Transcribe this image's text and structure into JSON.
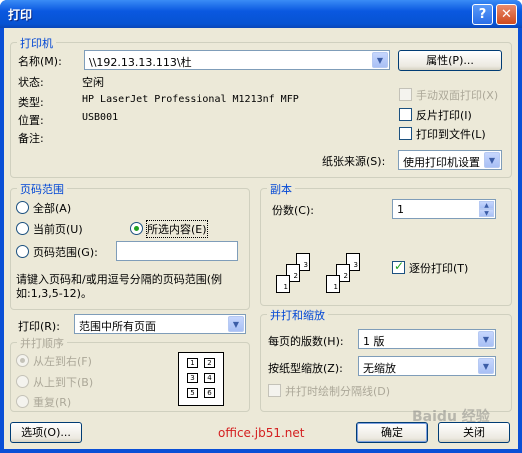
{
  "window": {
    "title": "打印",
    "help": "?",
    "close": "✕"
  },
  "printer": {
    "group_title": "打印机",
    "name_label": "名称(M):",
    "name_value": "\\\\192.13.13.113\\杜",
    "properties_btn": "属性(P)...",
    "status_label": "状态:",
    "status_value": "空闲",
    "type_label": "类型:",
    "type_value": "HP LaserJet Professional M1213nf MFP",
    "where_label": "位置:",
    "where_value": "USB001",
    "comment_label": "备注:",
    "manual_duplex": "手动双面打印(X)",
    "manual_duplex_checked": false,
    "reverse_print": "反片打印(I)",
    "reverse_checked": false,
    "print_to_file": "打印到文件(L)",
    "print_to_file_checked": false,
    "paper_source_label": "纸张来源(S):",
    "paper_source_value": "使用打印机设置"
  },
  "page_range": {
    "group_title": "页码范围",
    "all": "全部(A)",
    "current": "当前页(U)",
    "selection": "所选内容(E)",
    "pages": "页码范围(G):",
    "selected": "selection",
    "hint": "请键入页码和/或用逗号分隔的页码范围(例如:1,3,5-12)。"
  },
  "copies": {
    "group_title": "副本",
    "count_label": "份数(C):",
    "count_value": "1",
    "collate": "逐份打印(T)",
    "collate_checked": true
  },
  "print_what": {
    "label": "打印(R):",
    "value": "范围中所有页面"
  },
  "order": {
    "group_title": "并打顺序",
    "ltr": "从左到右(F)",
    "ttb": "从上到下(B)",
    "repeat": "重复(R)",
    "cells": [
      "1",
      "2",
      "3",
      "4",
      "5",
      "6"
    ]
  },
  "zoom": {
    "group_title": "并打和缩放",
    "pages_per_sheet_label": "每页的版数(H):",
    "pages_per_sheet_value": "1 版",
    "scale_label": "按纸型缩放(Z):",
    "scale_value": "无缩放",
    "draw_borders": "并打时绘制分隔线(D)"
  },
  "buttons": {
    "options": "选项(O)...",
    "ok": "确定",
    "close": "关闭"
  },
  "watermark": {
    "site": "office.jb51.net",
    "brand": "Baidu 经验"
  }
}
